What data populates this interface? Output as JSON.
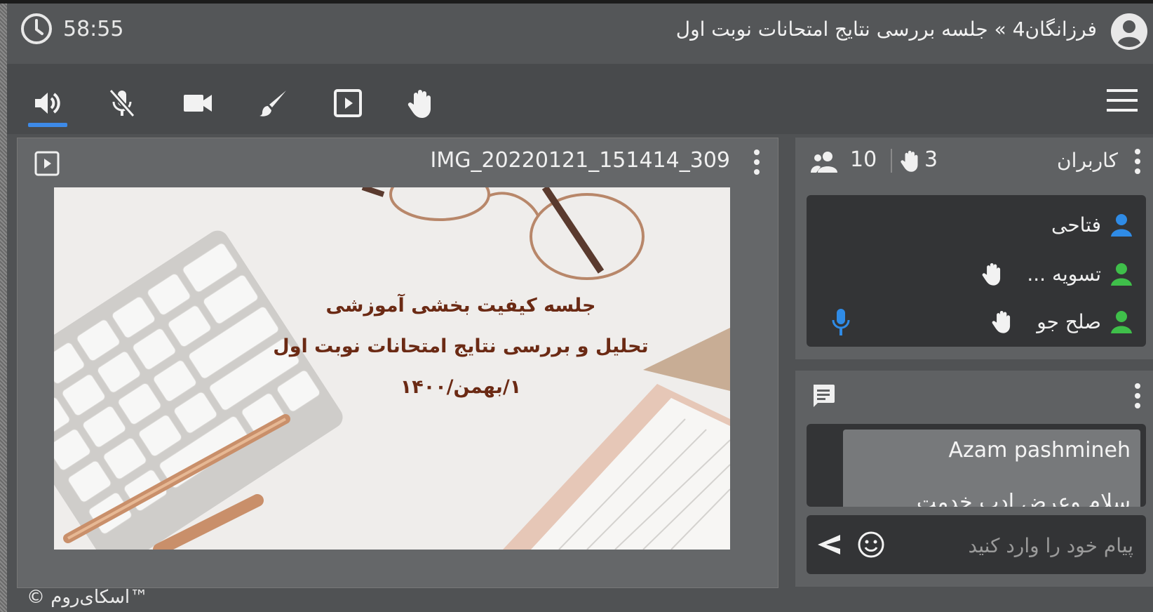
{
  "header": {
    "timer": "58:55",
    "title": "فرزانگان4 » جلسه بررسی نتایج امتحانات نوبت اول"
  },
  "toolbar": {
    "icons": [
      "speaker-icon",
      "mic-off-icon",
      "camera-icon",
      "brush-icon",
      "present-icon",
      "raise-hand-icon"
    ],
    "menu_icon": "menu-icon",
    "active_color": "#3d8ae8"
  },
  "presentation": {
    "file_name": "IMG_20220121_151414_309",
    "slide_lines": [
      "جلسه کیفیت بخشی آموزشی",
      "تحلیل و بررسی نتایج امتحانات نوبت اول",
      "۱/بهمن/۱۴۰۰"
    ]
  },
  "users_panel": {
    "title": "کاربران",
    "user_count": "10",
    "hand_count": "3",
    "users": [
      {
        "name": "فتاحی",
        "color": "#2f8be6",
        "hand": false,
        "mic": false
      },
      {
        "name": "تسویه ...",
        "color": "#3fbf4a",
        "hand": true,
        "mic": false
      },
      {
        "name": "صلح جو",
        "color": "#3fbf4a",
        "hand": true,
        "mic": true
      }
    ]
  },
  "chat": {
    "sender": "Azam pashmineh",
    "message": "سلام وعرض ادب خدمت",
    "placeholder": "پیام خود را وارد کنید"
  },
  "footer": {
    "brand": "™اسکای‌روم ©"
  }
}
